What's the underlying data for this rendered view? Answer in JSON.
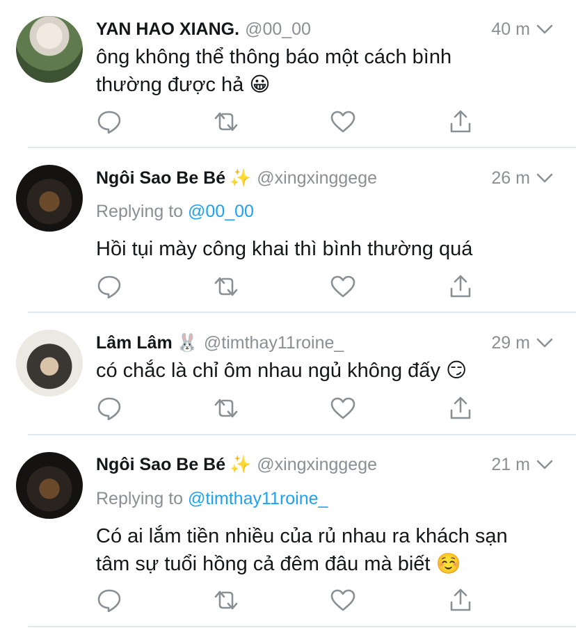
{
  "tweets": [
    {
      "name": "YAN HAO XIANG.",
      "name_emoji": "",
      "handle": "@00_00",
      "time": "40 m",
      "replying_label": "",
      "replying_to": "",
      "text_lines": [
        "ông không thể thông báo một cách bình",
        "thường được hả 😀"
      ]
    },
    {
      "name": "Ngôi Sao Be Bé",
      "name_emoji": "✨",
      "handle": "@xingxinggege",
      "time": "26 m",
      "replying_label": "Replying to",
      "replying_to": "@00_00",
      "text_lines": [
        "Hồi tụi mày công khai thì bình thường quá"
      ]
    },
    {
      "name": "Lâm Lâm",
      "name_emoji": "🐰",
      "handle": "@timthay11roine_",
      "time": "29 m",
      "replying_label": "",
      "replying_to": "",
      "text_lines": [
        "có chắc là chỉ ôm nhau ngủ không đấy 😏"
      ]
    },
    {
      "name": "Ngôi Sao Be Bé",
      "name_emoji": "✨",
      "handle": "@xingxinggege",
      "time": "21 m",
      "replying_label": "Replying to",
      "replying_to": "@timthay11roine_",
      "text_lines": [
        "Có ai lắm tiền nhiều của rủ nhau ra khách sạn",
        "tâm sự tuổi hồng cả đêm đâu mà biết ☺️"
      ]
    }
  ],
  "icons": {
    "reply": "reply-icon",
    "retweet": "retweet-icon",
    "like": "heart-icon",
    "share": "share-icon",
    "menu": "chevron-down-icon"
  },
  "colors": {
    "text": "#14171a",
    "secondary": "#8a8f94",
    "mention": "#1da1f2",
    "icon": "#8a8f94",
    "divider": "#e1e8ed"
  }
}
